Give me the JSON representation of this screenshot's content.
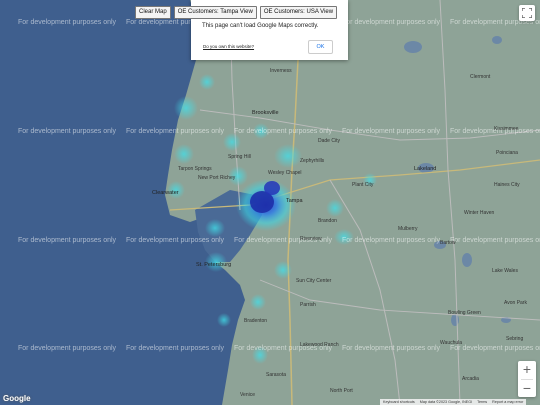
{
  "controls": {
    "clear_map": "Clear Map",
    "tampa_view": "OE Customers: Tampa View",
    "usa_view": "OE Customers: USA View"
  },
  "dialog": {
    "message": "This page can't load Google Maps correctly.",
    "own_website_link": "Do you own this website?",
    "ok_button": "OK"
  },
  "watermark": "For development purposes only",
  "places": {
    "crystal_river": "Crystal River",
    "inverness": "Inverness",
    "brooksville": "Brooksville",
    "spring_hill": "Spring Hill",
    "new_port_richey": "New Port Richey",
    "zephyrhills": "Zephyrhills",
    "dade_city": "Dade City",
    "wesley_chapel": "Wesley Chapel",
    "clermont": "Clermont",
    "tarpon_springs": "Tarpon Springs",
    "clearwater": "Clearwater",
    "tampa": "Tampa",
    "plant_city": "Plant City",
    "lakeland": "Lakeland",
    "brandon": "Brandon",
    "st_petersburg": "St. Petersburg",
    "bradenton": "Bradenton",
    "sarasota": "Sarasota",
    "winter_haven": "Winter Haven",
    "bartow": "Bartow",
    "riverview": "Riverview",
    "sun_city_center": "Sun City Center",
    "haines_city": "Haines City",
    "lake_wales": "Lake Wales",
    "wauchula": "Wauchula",
    "arcadia": "Arcadia",
    "north_port": "North Port",
    "lakewood_ranch": "Lakewood Ranch",
    "mulberry": "Mulberry",
    "parrish": "Parrish",
    "avon_park": "Avon Park",
    "sebring": "Sebring",
    "kissimmee": "Kissimmee",
    "poinciana": "Poinciana",
    "venice": "Venice",
    "bowling_green": "Bowling Green"
  },
  "footer": {
    "shortcuts": "Keyboard shortcuts",
    "map_data": "Map data ©2023 Google, INEGI",
    "terms": "Terms",
    "report": "Report a map error"
  },
  "logo": "Google",
  "zoom": {
    "in": "+",
    "out": "−"
  },
  "colors": {
    "water": "#3f5f8e",
    "land": "#8ea397",
    "heat_core": "#1d2fa8",
    "heat_mid": "#2f7de6",
    "heat_edge": "#39d9e8"
  },
  "icons": {
    "fullscreen": "fullscreen-icon"
  }
}
